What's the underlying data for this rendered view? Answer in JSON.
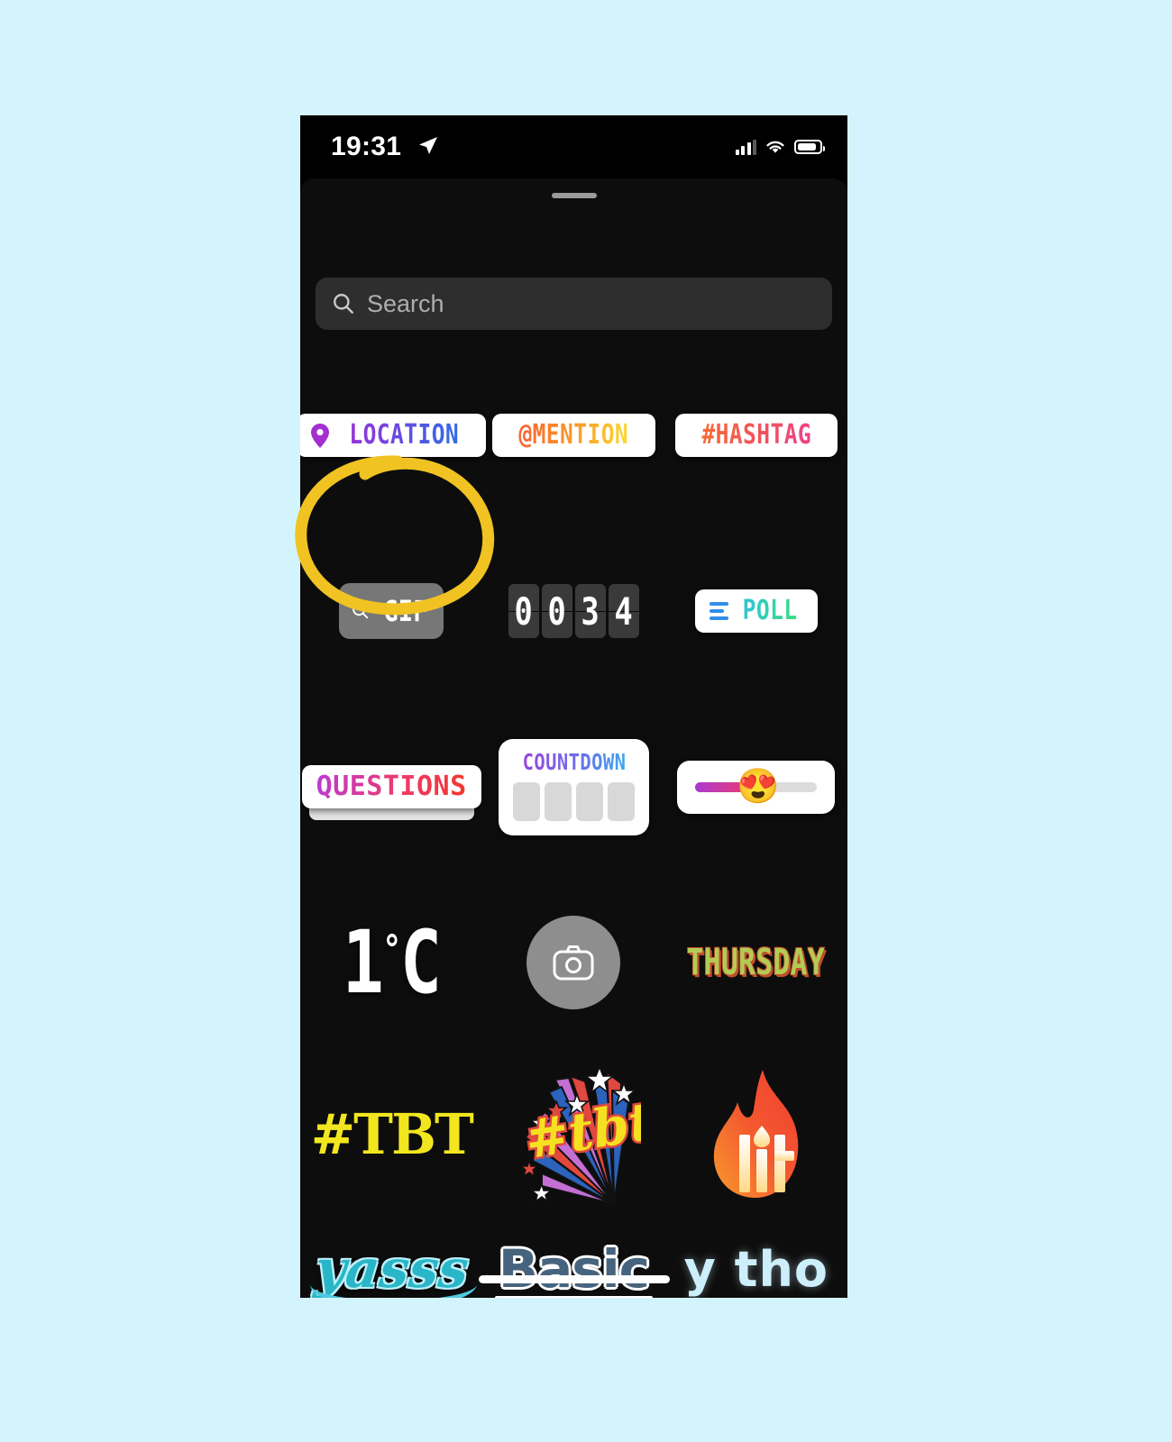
{
  "background_color": "#d3f4fc",
  "device": {
    "status_bar": {
      "time": "19:31",
      "location_arrow_icon": "location-arrow-icon",
      "cellular_icon": "cellular-signal-icon",
      "cellular_bars_filled": 3,
      "cellular_bars_total": 4,
      "wifi_icon": "wifi-icon",
      "battery_icon": "battery-icon",
      "battery_level_percent": 80
    },
    "home_indicator": "home-indicator"
  },
  "sheet": {
    "grabber": "sheet-grabber-handle",
    "search": {
      "icon": "search-icon",
      "placeholder": "Search",
      "value": ""
    }
  },
  "annotation": {
    "shape": "hand-drawn-circle",
    "color": "#f0c322",
    "target": "GIF sticker button"
  },
  "stickers": {
    "rows": [
      {
        "row": 1,
        "items": [
          {
            "id": "location",
            "label": "LOCATION",
            "style": "white-pill",
            "icon": "map-pin-icon",
            "gradient_class": "g-location"
          },
          {
            "id": "mention",
            "label": "@MENTION",
            "style": "white-pill",
            "gradient_class": "g-mention"
          },
          {
            "id": "hashtag",
            "label": "#HASHTAG",
            "style": "white-pill",
            "gradient_class": "g-hashtag"
          }
        ]
      },
      {
        "row": 2,
        "items": [
          {
            "id": "gif",
            "label": "GIF",
            "style": "gray-button",
            "icon": "search-icon",
            "highlighted": true
          },
          {
            "id": "countdown-digits",
            "label": "0034",
            "style": "flip-clock",
            "digits": [
              "0",
              "0",
              "3",
              "4"
            ]
          },
          {
            "id": "poll",
            "label": "POLL",
            "style": "white-pill",
            "icon": "poll-bars-icon",
            "gradient_class": "g-poll"
          }
        ]
      },
      {
        "row": 3,
        "items": [
          {
            "id": "questions",
            "label": "QUESTIONS",
            "style": "white-card-stacked",
            "gradient_class": "g-questions"
          },
          {
            "id": "countdown",
            "label": "COUNTDOWN",
            "style": "white-card",
            "gradient_class": "g-countdown",
            "tiles": 4
          },
          {
            "id": "emoji-slider",
            "label": "",
            "style": "white-card-slider",
            "emoji": "😍",
            "fill_percent": 45
          }
        ]
      },
      {
        "row": 4,
        "items": [
          {
            "id": "temperature",
            "label": "1",
            "unit": "°C",
            "degree": "°",
            "suffix": "C",
            "style": "plain-text"
          },
          {
            "id": "camera",
            "label": "",
            "style": "gray-circle",
            "icon": "camera-icon"
          },
          {
            "id": "weekday",
            "label": "THURSDAY",
            "style": "retro-shadow-text",
            "text_color": "#b3cb55",
            "shadow_color": "#c24f2a"
          }
        ]
      },
      {
        "row": 5,
        "items": [
          {
            "id": "tbt-plain",
            "label": "#TBT",
            "style": "bold-yellow-text",
            "color": "#f2e61e"
          },
          {
            "id": "tbt-burst",
            "label": "#tbt",
            "style": "burst-graphic-sticker"
          },
          {
            "id": "lit",
            "label": "lit",
            "style": "flame-graphic-sticker"
          }
        ]
      },
      {
        "row": 6,
        "items": [
          {
            "id": "yasss",
            "label": "yasss",
            "style": "teal-script",
            "color": "#29b6c8"
          },
          {
            "id": "basic",
            "label": "Basic",
            "style": "outlined-bold",
            "color": "#47647e"
          },
          {
            "id": "ytho",
            "label": "y tho",
            "style": "soft-blue-bold",
            "color": "#cdeefb"
          }
        ]
      }
    ]
  }
}
